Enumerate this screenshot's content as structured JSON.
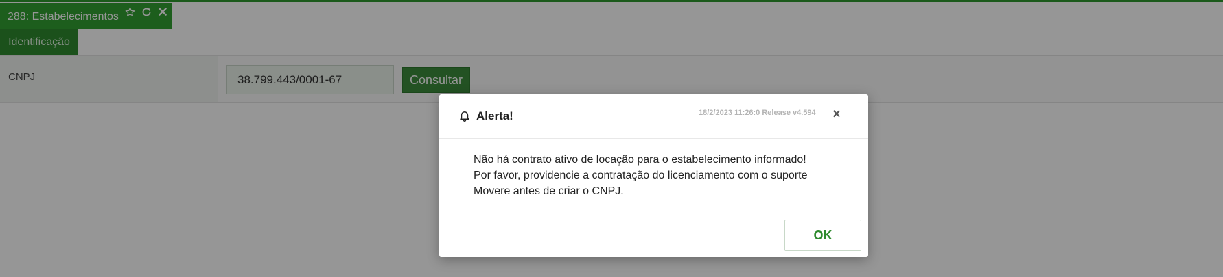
{
  "tab": {
    "title": "288: Estabelecimentos",
    "icons": [
      "star-icon",
      "refresh-icon",
      "close-icon"
    ]
  },
  "section_button": {
    "label": "Identificação"
  },
  "form": {
    "cnpj_label": "CNPJ",
    "cnpj_value": "38.799.443/0001-67",
    "consultar_label": "Consultar"
  },
  "modal": {
    "icon": "bell-icon",
    "title": "Alerta!",
    "meta": "18/2/2023 11:26:0 Release v4.594",
    "close_label": "×",
    "message_lines": [
      "Não há contrato ativo de locação para o estabelecimento informado!",
      "Por favor, providencie a contratação do licenciamento com o suporte",
      "Movere antes de criar o CNPJ."
    ],
    "ok_label": "OK"
  },
  "colors": {
    "brand_green": "#32a032",
    "dark_green": "#2e8a2e",
    "overlay": "rgba(0,0,0,0.41)"
  }
}
